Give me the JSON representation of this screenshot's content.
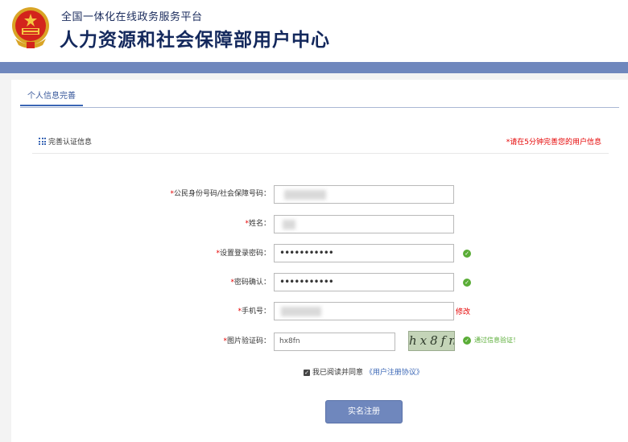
{
  "header": {
    "subtitle": "全国一体化在线政务服务平台",
    "title": "人力资源和社会保障部用户中心"
  },
  "tabs": [
    {
      "label": "个人信息完善"
    }
  ],
  "section": {
    "title": "完善认证信息",
    "warning": "*请在5分钟完善您的用户信息"
  },
  "form": {
    "required_mark": "*",
    "id_number": {
      "label": "公民身份号码/社会保障号码：",
      "value": ""
    },
    "name": {
      "label": "姓名：",
      "value": ""
    },
    "password": {
      "label": "设置登录密码：",
      "value": "•••••••••••"
    },
    "confirm_password": {
      "label": "密码确认：",
      "value": "•••••••••••"
    },
    "phone": {
      "label": "手机号：",
      "value": "",
      "modify_label": "修改"
    },
    "captcha": {
      "label": "图片验证码：",
      "value": "hx8fn",
      "image_text": "hx8fn",
      "pass_text": "通过信息验证！"
    }
  },
  "agreement": {
    "text": "我已阅读并同意",
    "link": "《用户注册协议》",
    "checked": true
  },
  "submit_label": "实名注册",
  "colors": {
    "accent": "#6f87bd",
    "title": "#13285c",
    "required": "#e50000",
    "success": "#5aad37"
  }
}
